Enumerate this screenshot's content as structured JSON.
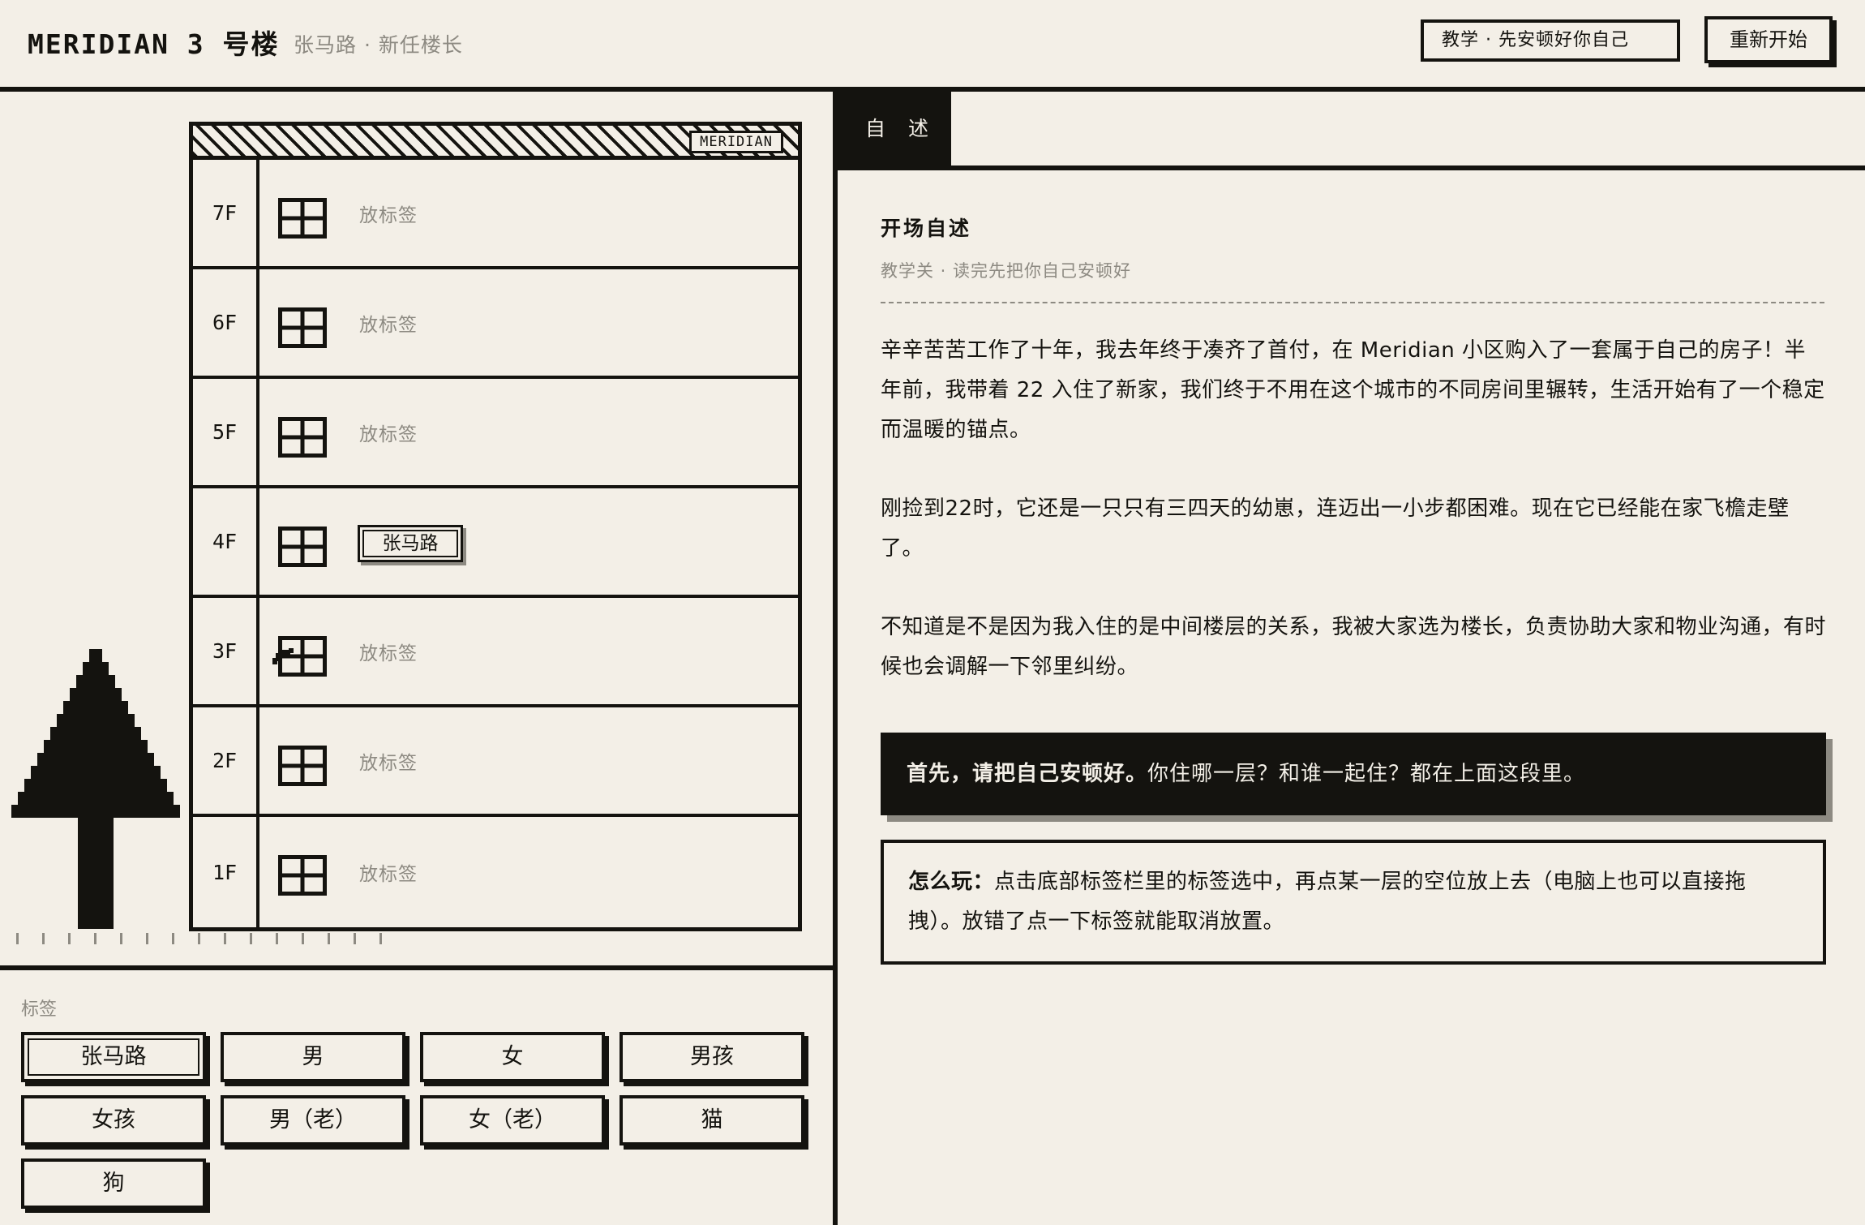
{
  "header": {
    "title": "MERIDIAN 3 号楼",
    "subtitle": "张马路 · 新任楼长",
    "mode": "教学  ·  先安顿好你自己",
    "restart_label": "重新开始"
  },
  "building": {
    "brand": "MERIDIAN",
    "floors": [
      {
        "label": "7F",
        "slot": "放标签"
      },
      {
        "label": "6F",
        "slot": "放标签"
      },
      {
        "label": "5F",
        "slot": "放标签"
      },
      {
        "label": "4F",
        "placed": "张马路"
      },
      {
        "label": "3F",
        "slot": "放标签"
      },
      {
        "label": "2F",
        "slot": "放标签"
      },
      {
        "label": "1F",
        "slot": "放标签"
      }
    ]
  },
  "tray": {
    "label": "标签",
    "tags": [
      "张马路",
      "男",
      "女",
      "男孩",
      "女孩",
      "男（老）",
      "女（老）",
      "猫",
      "狗"
    ],
    "selected": "张马路"
  },
  "panel": {
    "tab": "自 述",
    "title": "开场自述",
    "subtitle": "教学关 · 读完先把你自己安顿好",
    "paragraphs": [
      "辛辛苦苦工作了十年，我去年终于凑齐了首付，在 Meridian 小区购入了一套属于自己的房子！半年前，我带着 22 入住了新家，我们终于不用在这个城市的不同房间里辗转，生活开始有了一个稳定而温暖的锚点。",
      "刚捡到22时，它还是一只只有三四天的幼崽，连迈出一小步都困难。现在它已经能在家飞檐走壁了。",
      "不知道是不是因为我入住的是中间楼层的关系，我被大家选为楼长，负责协助大家和物业沟通，有时候也会调解一下邻里纠纷。"
    ],
    "prompt_bold": "首先，请把自己安顿好。",
    "prompt_rest": "你住哪一层？和谁一起住？都在上面这段里。",
    "howto_bold": "怎么玩：",
    "howto_rest": "点击底部标签栏里的标签选中，再点某一层的空位放上去（电脑上也可以直接拖拽）。放错了点一下标签就能取消放置。"
  },
  "colors": {
    "ink": "#14130f",
    "paper": "#f3efe7",
    "muted": "#8d8a82"
  }
}
